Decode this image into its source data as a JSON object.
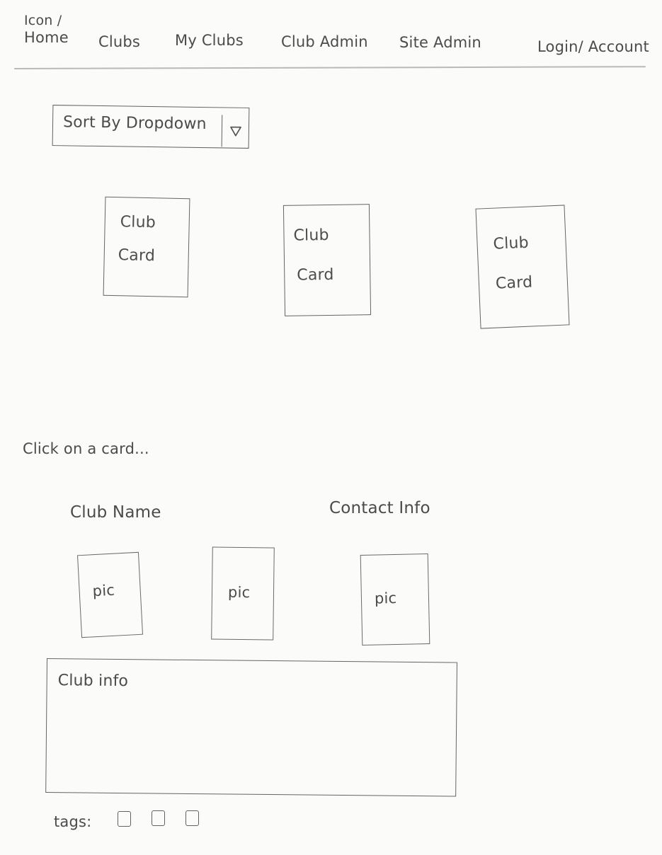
{
  "nav": {
    "home": {
      "icon_label": "Icon /",
      "label": "Home"
    },
    "clubs": "Clubs",
    "my_clubs": "My Clubs",
    "club_admin": "Club Admin",
    "site_admin": "Site Admin",
    "account": "Login/ Account"
  },
  "sort": {
    "label": "Sort By Dropdown",
    "icon": "triangle-down"
  },
  "cards": [
    {
      "line1": "Club",
      "line2": "Card"
    },
    {
      "line1": "Club",
      "line2": "Card"
    },
    {
      "line1": "Club",
      "line2": "Card"
    }
  ],
  "prompt": "Click on a card...",
  "club_detail": {
    "name": "Club Name",
    "contact": "Contact Info",
    "pictures": [
      "pic",
      "pic",
      "pic"
    ],
    "info_label": "Club info",
    "tags_label": "tags:"
  }
}
